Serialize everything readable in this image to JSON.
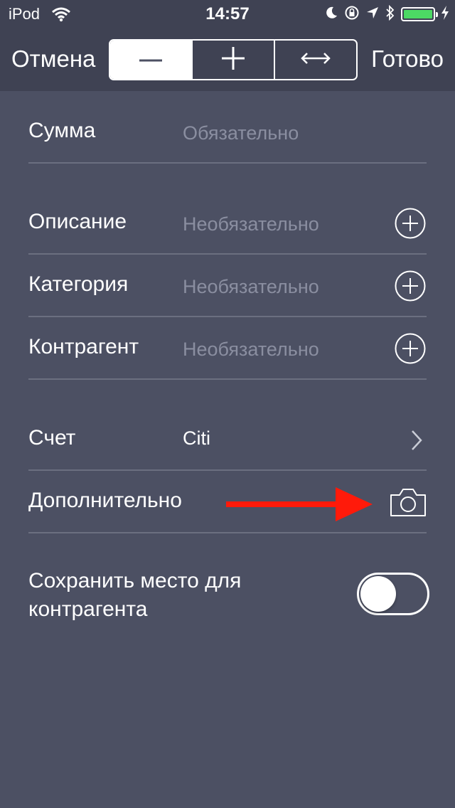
{
  "status_bar": {
    "carrier": "iPod",
    "time": "14:57"
  },
  "nav": {
    "cancel_label": "Отмена",
    "done_label": "Готово",
    "segments": [
      {
        "icon": "minus-icon",
        "selected": true
      },
      {
        "icon": "plus-icon",
        "selected": false
      },
      {
        "icon": "transfer-arrows-icon",
        "selected": false
      }
    ]
  },
  "form": {
    "amount": {
      "label": "Сумма",
      "placeholder": "Обязательно"
    },
    "description": {
      "label": "Описание",
      "placeholder": "Необязательно"
    },
    "category": {
      "label": "Категория",
      "placeholder": "Необязательно"
    },
    "counterparty": {
      "label": "Контрагент",
      "placeholder": "Необязательно"
    },
    "account": {
      "label": "Счет",
      "value": "Citi"
    },
    "extra": {
      "label": "Дополнительно"
    },
    "save_location": {
      "label_line1": "Сохранить место для",
      "label_line2": "контрагента",
      "enabled": false
    }
  },
  "colors": {
    "background": "#4c5063",
    "topbar": "#3f4253",
    "battery": "#4cd964",
    "annotation_arrow": "#ff1a0a"
  }
}
